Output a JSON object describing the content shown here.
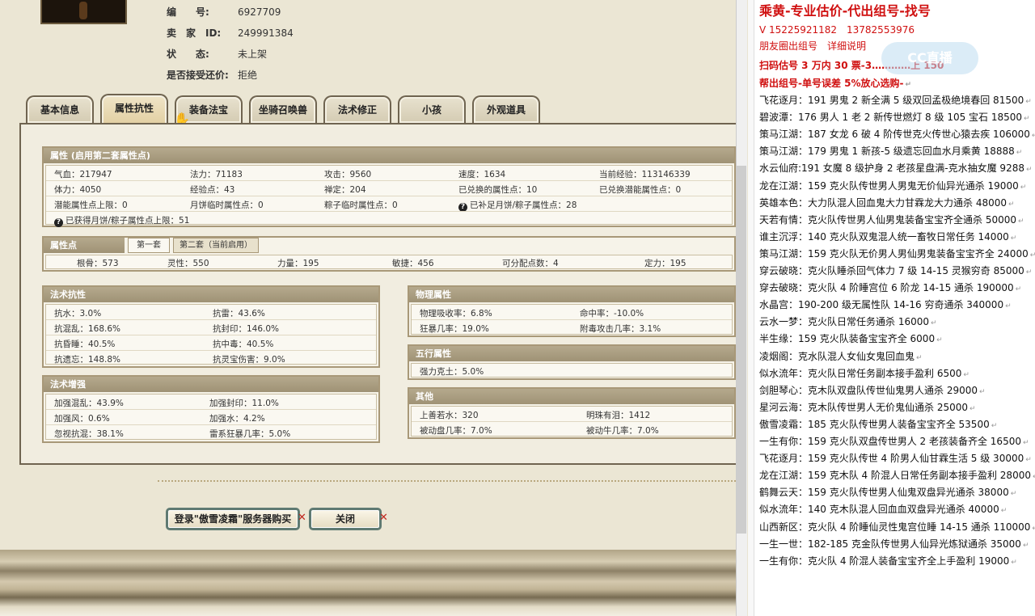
{
  "header": {
    "rows": [
      {
        "key": "编　　号:",
        "value": "6927709"
      },
      {
        "key": "卖　家　ID:",
        "value": "249991384"
      },
      {
        "key": "状　　态:",
        "value": "未上架"
      },
      {
        "key": "是否接受还价:",
        "value": "拒绝"
      }
    ]
  },
  "tabs": [
    "基本信息",
    "属性抗性",
    "装备法宝",
    "坐骑召唤兽",
    "法术修正",
    "小孩",
    "外观道具"
  ],
  "attributes": {
    "title": "属性 (启用第二套属性点)",
    "rows": [
      [
        "气血：217947",
        "法力：71183",
        "攻击：9560",
        "速度：1634",
        "当前经验：113146339"
      ],
      [
        "体力：4050",
        "经验点：43",
        "禅定：204",
        "已兑换的属性点：10",
        "已兑换潜能属性点：0"
      ],
      [
        "潜能属性点上限：0",
        "月饼临时属性点：0",
        "粽子临时属性点：0",
        "已补足月饼/粽子属性点：28",
        ""
      ],
      [
        "已获得月饼/粽子属性点上限：51"
      ]
    ]
  },
  "points": {
    "title": "属性点",
    "subtab1": "第一套",
    "subtab2": "第二套（当前启用）",
    "row": [
      "根骨：573",
      "灵性：550",
      "力量：195",
      "敏捷：456",
      "可分配点数：4",
      "定力：195"
    ]
  },
  "resist": {
    "title": "法术抗性",
    "rows": [
      [
        "抗水：3.0%",
        "抗雷：43.6%"
      ],
      [
        "抗混乱：168.6%",
        "抗封印：146.0%"
      ],
      [
        "抗昏睡：40.5%",
        "抗中毒：40.5%"
      ],
      [
        "抗遗忘：148.8%",
        "抗灵宝伤害：9.0%"
      ]
    ]
  },
  "enhance": {
    "title": "法术增强",
    "rows": [
      [
        "加强混乱：43.9%",
        "加强封印：11.0%"
      ],
      [
        "加强风：0.6%",
        "加强水：4.2%"
      ],
      [
        "忽视抗混：38.1%",
        "雷系狂暴几率：5.0%"
      ]
    ]
  },
  "physical": {
    "title": "物理属性",
    "rows": [
      [
        "物理吸收率：6.8%",
        "命中率：-10.0%"
      ],
      [
        "狂暴几率：19.0%",
        "附毒攻击几率：3.1%"
      ]
    ]
  },
  "wuxing": {
    "title": "五行属性",
    "rows": [
      [
        "强力克土：5.0%"
      ]
    ]
  },
  "other": {
    "title": "其他",
    "rows": [
      [
        "上善若水：320",
        "明珠有泪：1412"
      ],
      [
        "被动盘几率：7.0%",
        "被动牛几率：7.0%"
      ]
    ]
  },
  "buttons": {
    "buy": "登录\"傲雪凌霜\"服务器购买",
    "close": "关闭"
  },
  "doc": {
    "watermark": "CC直播",
    "lines": [
      {
        "text": "乘黄-专业估价-代出组号-找号",
        "style": "red big"
      },
      {
        "text": "V 15225921182　13782553976",
        "style": "red"
      },
      {
        "text": "朋友圈出组号　详细说明",
        "style": "red"
      },
      {
        "text": "扫码估号 3 万内 30 票-3…………上 150",
        "style": "red bold"
      },
      {
        "text": "帮出组号-单号误差 5%放心选购-",
        "style": "red bold"
      },
      {
        "text": "飞花逐月：191 男鬼 2 新全满 5 级双回孟极绝境春回 81500"
      },
      {
        "text": "碧波潭：176 男人 1 老 2 新传世燃灯 8 级 105 宝石 18500"
      },
      {
        "text": "策马江湖：187 女龙 6 破 4 阶传世克火传世心猿去疾 106000"
      },
      {
        "text": "策马江湖：179 男鬼 1 新孩-5 级遗忘回血水月乘黄 18888"
      },
      {
        "text": "水云仙府:191 女魔 8 级护身 2 老孩星盘满-克水抽女魔 9288"
      },
      {
        "text": "龙在江湖：159 克火队传世男人男鬼无价仙异光通杀 19000"
      },
      {
        "text": "英雄本色：大力队混人回血鬼大力甘霖龙大力通杀 48000"
      },
      {
        "text": "天若有情：克火队传世男人仙男鬼装备宝宝齐全通杀 50000"
      },
      {
        "text": "谁主沉浮：140 克火队双鬼混人统一畜牧日常任务 14000"
      },
      {
        "text": "策马江湖：159 克火队无价男人男仙男鬼装备宝宝齐全 24000"
      },
      {
        "text": "穿云破晓：克火队睡杀回气体力 7 级 14-15 灵猴穷奇 85000"
      },
      {
        "text": "穿去破晓：克火队 4 阶睡宫位 6 阶龙 14-15 通杀 190000"
      },
      {
        "text": "水晶宫：190-200 级无属性队 14-16 穷奇通杀 340000"
      },
      {
        "text": "云水一梦：克火队日常任务通杀 16000"
      },
      {
        "text": "半生缘：159 克火队装备宝宝齐全 6000"
      },
      {
        "text": "凌烟阁：克水队混人女仙女鬼回血鬼"
      },
      {
        "text": "似水流年：克火队日常任务副本接手盈利 6500"
      },
      {
        "text": "剑胆琴心：克木队双盘队传世仙鬼男人通杀 29000"
      },
      {
        "text": "星河云海：克木队传世男人无价鬼仙通杀 25000"
      },
      {
        "text": "傲雪凌霜：185 克火队传世男人装备宝宝齐全 53500"
      },
      {
        "text": "一生有你：159 克火队双盘传世男人 2 老孩装备齐全 16500"
      },
      {
        "text": "飞花逐月：159 克火队传世 4 阶男人仙甘霖生活 5 级 30000"
      },
      {
        "text": "龙在江湖：159 克木队 4 阶混人日常任务副本接手盈利 28000"
      },
      {
        "text": "鹤舞云天：159 克火队传世男人仙鬼双盘异光通杀 38000"
      },
      {
        "text": "似水流年：140 克木队混人回血血双盘异光通杀 40000"
      },
      {
        "text": "山西新区：克火队 4 阶睡仙灵性鬼宫位睡 14-15 通杀 110000"
      },
      {
        "text": "一生一世：182-185 克金队传世男人仙异光炼狱通杀 35000"
      },
      {
        "text": "一生有你：克火队 4 阶混人装备宝宝齐全上手盈利 19000"
      }
    ]
  }
}
